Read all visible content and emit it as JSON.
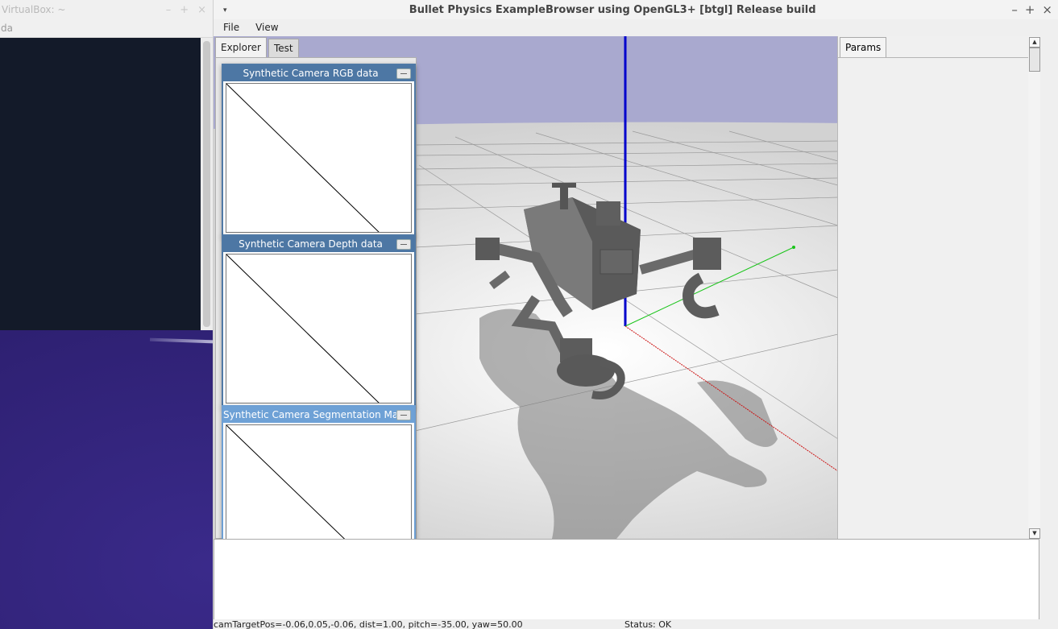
{
  "background_window": {
    "title": "VirtualBox: ~",
    "menu_label": "da",
    "buttons": [
      "–",
      "+",
      "×"
    ]
  },
  "main_window": {
    "menu_icon": "▾",
    "title": "Bullet Physics ExampleBrowser using OpenGL3+ [btgl] Release build",
    "buttons": {
      "minimize": "–",
      "maximize": "+",
      "close": "×"
    },
    "menu": [
      "File",
      "View"
    ]
  },
  "explorer": {
    "tabs": [
      "Explorer",
      "Test"
    ],
    "camera_windows": [
      {
        "title": "Synthetic Camera RGB data"
      },
      {
        "title": "Synthetic Camera Depth data"
      },
      {
        "title": "Synthetic Camera Segmentation Mask"
      }
    ]
  },
  "params": {
    "tab": "Params"
  },
  "status": {
    "left": "camTargetPos=-0.06,0.05,-0.06, dist=1.00, pitch=-35.00, yaw=50.00",
    "right": "Status: OK"
  },
  "colors": {
    "sky": "#a9a9cf",
    "floor": "#e6e6e6",
    "axis_z": "#0000cc",
    "axis_y": "#19c419",
    "axis_x": "#cc1111",
    "camera_title": "#4d77a4"
  }
}
